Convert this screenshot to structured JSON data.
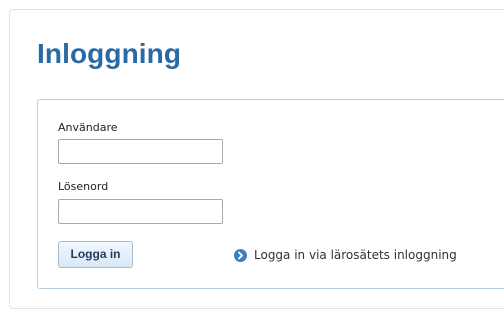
{
  "page": {
    "title": "Inloggning"
  },
  "form": {
    "username_label": "Användare",
    "username_value": "",
    "password_label": "Lösenord",
    "password_value": "",
    "login_button_label": "Logga in",
    "institution_login_link": "Logga in via lärosätets inloggning"
  },
  "colors": {
    "title": "#2a6aa3",
    "box_border": "#b8d0e6",
    "link_icon": "#3c7fc1"
  },
  "icons": {
    "link_icon": "chevron-right-circle-icon"
  }
}
